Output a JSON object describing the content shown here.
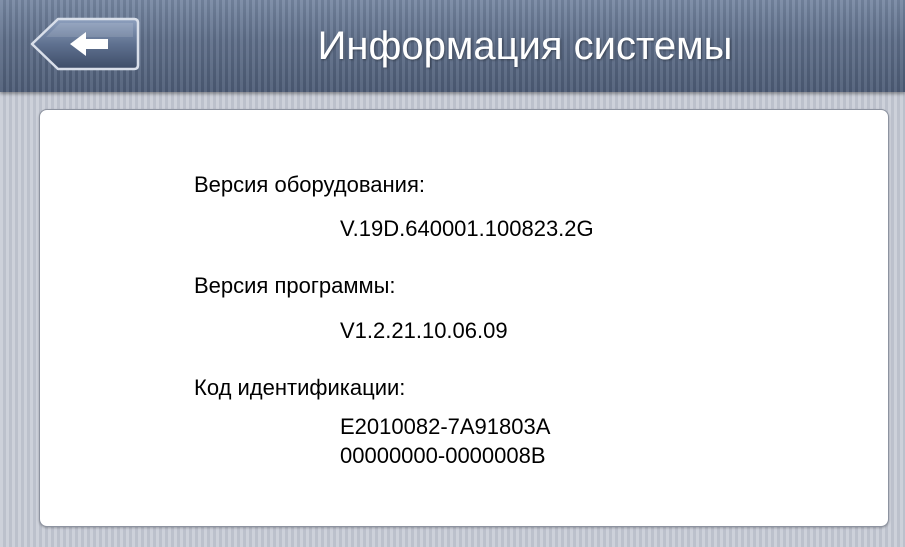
{
  "header": {
    "back_icon": "left-arrow-icon",
    "title": "Информация системы"
  },
  "info": {
    "hardware_label": "Версия оборудования:",
    "hardware_value": "V.19D.640001.100823.2G",
    "software_label": "Версия программы:",
    "software_value": "V1.2.21.10.06.09",
    "id_label": "Код идентификации:",
    "id_value_line1": "E2010082-7A91803A",
    "id_value_line2": "00000000-0000008B"
  },
  "colors": {
    "header": "#5e6e89",
    "background": "#c6cad4",
    "panel": "#ffffff",
    "text": "#000000",
    "title_text": "#ffffff"
  }
}
